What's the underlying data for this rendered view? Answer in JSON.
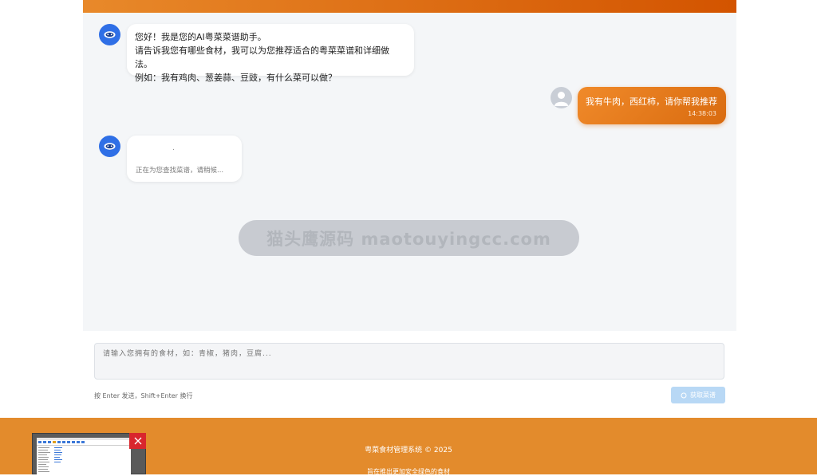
{
  "chat": {
    "welcome_lines": [
      "您好！我是您的AI粤菜菜谱助手。",
      "请告诉我您有哪些食材，我可以为您推荐适合的粤菜菜谱和详细做法。",
      "例如：我有鸡肉、葱姜蒜、豆豉，有什么菜可以做？"
    ],
    "user_message": "我有牛肉，西红柿，请你帮我推荐",
    "user_time": "14:38:03",
    "loading_dot": ".",
    "loading_text": "正在为您查找菜谱，请稍候..."
  },
  "watermark": "猫头鹰源码 maotouyingcc.com",
  "input": {
    "placeholder": "请输入您拥有的食材，如：青椒，猪肉，豆腐...",
    "hint": "按 Enter 发送，Shift+Enter 换行",
    "send_label": "获取菜谱",
    "send_icon": "spinner-icon"
  },
  "footer": {
    "copyright": "粤菜食材管理系统 © 2025",
    "slogan": "旨在推出更加安全绿色的食材"
  },
  "colors": {
    "accent": "#e38b2c",
    "header_gradient_end": "#d35400",
    "bot_avatar": "#2f6fe6",
    "send_disabled": "#b8d8f5"
  }
}
